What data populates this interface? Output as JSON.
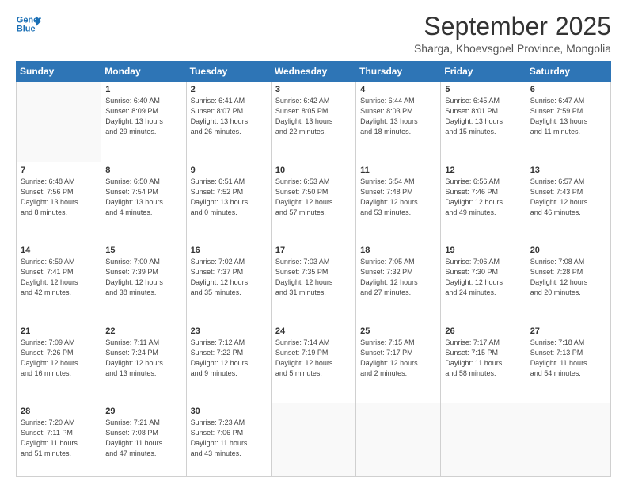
{
  "header": {
    "logo_line1": "General",
    "logo_line2": "Blue",
    "title": "September 2025",
    "subtitle": "Sharga, Khoevsgoel Province, Mongolia"
  },
  "weekdays": [
    "Sunday",
    "Monday",
    "Tuesday",
    "Wednesday",
    "Thursday",
    "Friday",
    "Saturday"
  ],
  "weeks": [
    [
      {
        "day": "",
        "info": ""
      },
      {
        "day": "1",
        "info": "Sunrise: 6:40 AM\nSunset: 8:09 PM\nDaylight: 13 hours\nand 29 minutes."
      },
      {
        "day": "2",
        "info": "Sunrise: 6:41 AM\nSunset: 8:07 PM\nDaylight: 13 hours\nand 26 minutes."
      },
      {
        "day": "3",
        "info": "Sunrise: 6:42 AM\nSunset: 8:05 PM\nDaylight: 13 hours\nand 22 minutes."
      },
      {
        "day": "4",
        "info": "Sunrise: 6:44 AM\nSunset: 8:03 PM\nDaylight: 13 hours\nand 18 minutes."
      },
      {
        "day": "5",
        "info": "Sunrise: 6:45 AM\nSunset: 8:01 PM\nDaylight: 13 hours\nand 15 minutes."
      },
      {
        "day": "6",
        "info": "Sunrise: 6:47 AM\nSunset: 7:59 PM\nDaylight: 13 hours\nand 11 minutes."
      }
    ],
    [
      {
        "day": "7",
        "info": "Sunrise: 6:48 AM\nSunset: 7:56 PM\nDaylight: 13 hours\nand 8 minutes."
      },
      {
        "day": "8",
        "info": "Sunrise: 6:50 AM\nSunset: 7:54 PM\nDaylight: 13 hours\nand 4 minutes."
      },
      {
        "day": "9",
        "info": "Sunrise: 6:51 AM\nSunset: 7:52 PM\nDaylight: 13 hours\nand 0 minutes."
      },
      {
        "day": "10",
        "info": "Sunrise: 6:53 AM\nSunset: 7:50 PM\nDaylight: 12 hours\nand 57 minutes."
      },
      {
        "day": "11",
        "info": "Sunrise: 6:54 AM\nSunset: 7:48 PM\nDaylight: 12 hours\nand 53 minutes."
      },
      {
        "day": "12",
        "info": "Sunrise: 6:56 AM\nSunset: 7:46 PM\nDaylight: 12 hours\nand 49 minutes."
      },
      {
        "day": "13",
        "info": "Sunrise: 6:57 AM\nSunset: 7:43 PM\nDaylight: 12 hours\nand 46 minutes."
      }
    ],
    [
      {
        "day": "14",
        "info": "Sunrise: 6:59 AM\nSunset: 7:41 PM\nDaylight: 12 hours\nand 42 minutes."
      },
      {
        "day": "15",
        "info": "Sunrise: 7:00 AM\nSunset: 7:39 PM\nDaylight: 12 hours\nand 38 minutes."
      },
      {
        "day": "16",
        "info": "Sunrise: 7:02 AM\nSunset: 7:37 PM\nDaylight: 12 hours\nand 35 minutes."
      },
      {
        "day": "17",
        "info": "Sunrise: 7:03 AM\nSunset: 7:35 PM\nDaylight: 12 hours\nand 31 minutes."
      },
      {
        "day": "18",
        "info": "Sunrise: 7:05 AM\nSunset: 7:32 PM\nDaylight: 12 hours\nand 27 minutes."
      },
      {
        "day": "19",
        "info": "Sunrise: 7:06 AM\nSunset: 7:30 PM\nDaylight: 12 hours\nand 24 minutes."
      },
      {
        "day": "20",
        "info": "Sunrise: 7:08 AM\nSunset: 7:28 PM\nDaylight: 12 hours\nand 20 minutes."
      }
    ],
    [
      {
        "day": "21",
        "info": "Sunrise: 7:09 AM\nSunset: 7:26 PM\nDaylight: 12 hours\nand 16 minutes."
      },
      {
        "day": "22",
        "info": "Sunrise: 7:11 AM\nSunset: 7:24 PM\nDaylight: 12 hours\nand 13 minutes."
      },
      {
        "day": "23",
        "info": "Sunrise: 7:12 AM\nSunset: 7:22 PM\nDaylight: 12 hours\nand 9 minutes."
      },
      {
        "day": "24",
        "info": "Sunrise: 7:14 AM\nSunset: 7:19 PM\nDaylight: 12 hours\nand 5 minutes."
      },
      {
        "day": "25",
        "info": "Sunrise: 7:15 AM\nSunset: 7:17 PM\nDaylight: 12 hours\nand 2 minutes."
      },
      {
        "day": "26",
        "info": "Sunrise: 7:17 AM\nSunset: 7:15 PM\nDaylight: 11 hours\nand 58 minutes."
      },
      {
        "day": "27",
        "info": "Sunrise: 7:18 AM\nSunset: 7:13 PM\nDaylight: 11 hours\nand 54 minutes."
      }
    ],
    [
      {
        "day": "28",
        "info": "Sunrise: 7:20 AM\nSunset: 7:11 PM\nDaylight: 11 hours\nand 51 minutes."
      },
      {
        "day": "29",
        "info": "Sunrise: 7:21 AM\nSunset: 7:08 PM\nDaylight: 11 hours\nand 47 minutes."
      },
      {
        "day": "30",
        "info": "Sunrise: 7:23 AM\nSunset: 7:06 PM\nDaylight: 11 hours\nand 43 minutes."
      },
      {
        "day": "",
        "info": ""
      },
      {
        "day": "",
        "info": ""
      },
      {
        "day": "",
        "info": ""
      },
      {
        "day": "",
        "info": ""
      }
    ]
  ]
}
